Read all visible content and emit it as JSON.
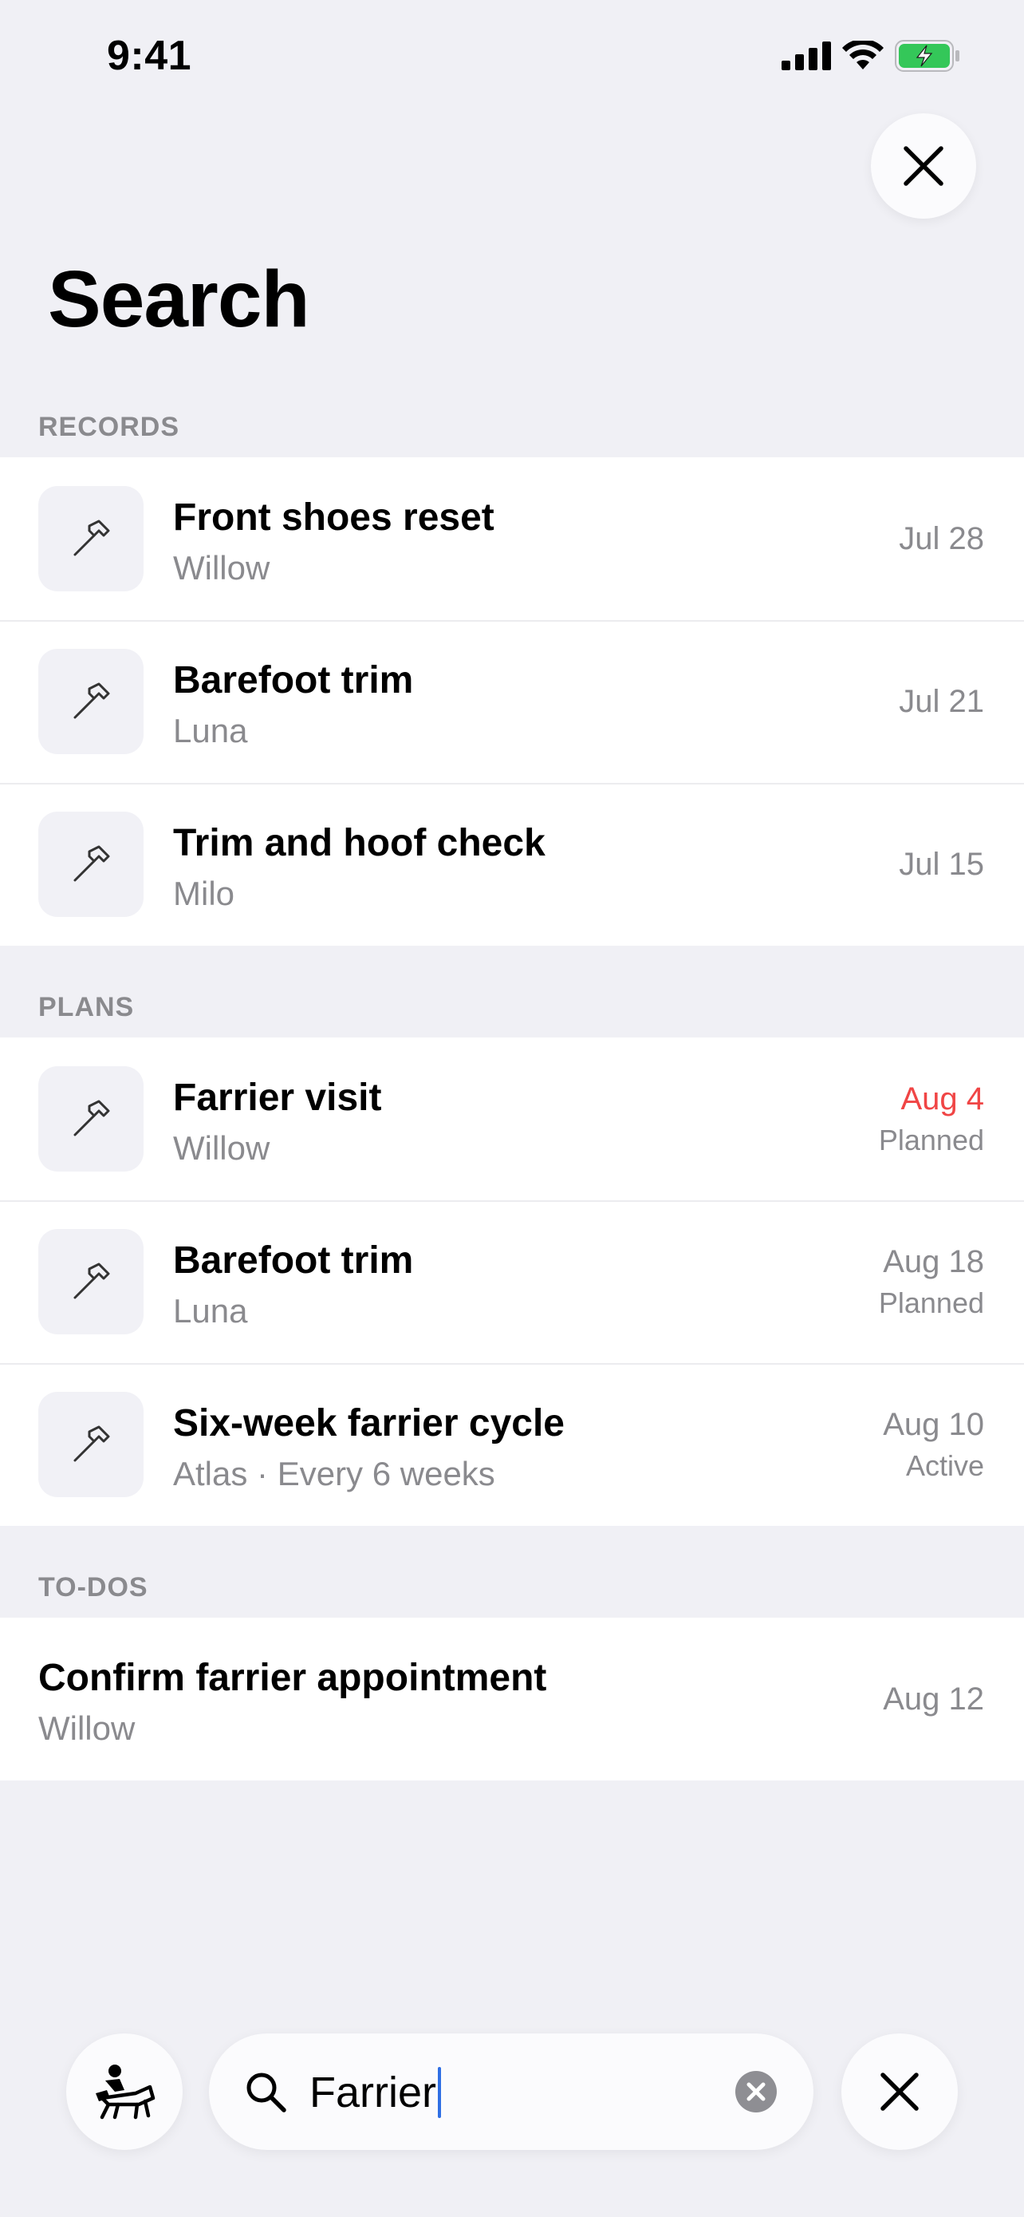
{
  "status_bar": {
    "time": "9:41"
  },
  "title": "Search",
  "sections": {
    "records": {
      "header": "RECORDS",
      "items": [
        {
          "title": "Front shoes reset",
          "subtitle": "Willow",
          "date": "Jul 28"
        },
        {
          "title": "Barefoot trim",
          "subtitle": "Luna",
          "date": "Jul 21"
        },
        {
          "title": "Trim and hoof check",
          "subtitle": "Milo",
          "date": "Jul 15"
        }
      ]
    },
    "plans": {
      "header": "PLANS",
      "items": [
        {
          "title": "Farrier visit",
          "subtitle": "Willow",
          "date": "Aug 4",
          "status": "Planned",
          "date_color": "#f04545"
        },
        {
          "title": "Barefoot trim",
          "subtitle": "Luna",
          "date": "Aug 18",
          "status": "Planned"
        },
        {
          "title": "Six-week farrier cycle",
          "subtitle": "Atlas · Every 6 weeks",
          "date": "Aug 10",
          "status": "Active"
        }
      ]
    },
    "todos": {
      "header": "TO-DOS",
      "items": [
        {
          "title": "Confirm farrier appointment",
          "subtitle": "Willow",
          "date": "Aug 12"
        }
      ]
    }
  },
  "search": {
    "value": "Farrier"
  },
  "icons": {
    "item": "hammer-icon",
    "top_close": "close-icon",
    "left_button": "horse-rider-icon",
    "search": "search-icon",
    "clear": "clear-icon",
    "right_button": "close-icon"
  },
  "colors": {
    "background": "#f0f0f5",
    "overdue": "#f04545",
    "caret": "#2f6fe4",
    "battery": "#34c759"
  }
}
